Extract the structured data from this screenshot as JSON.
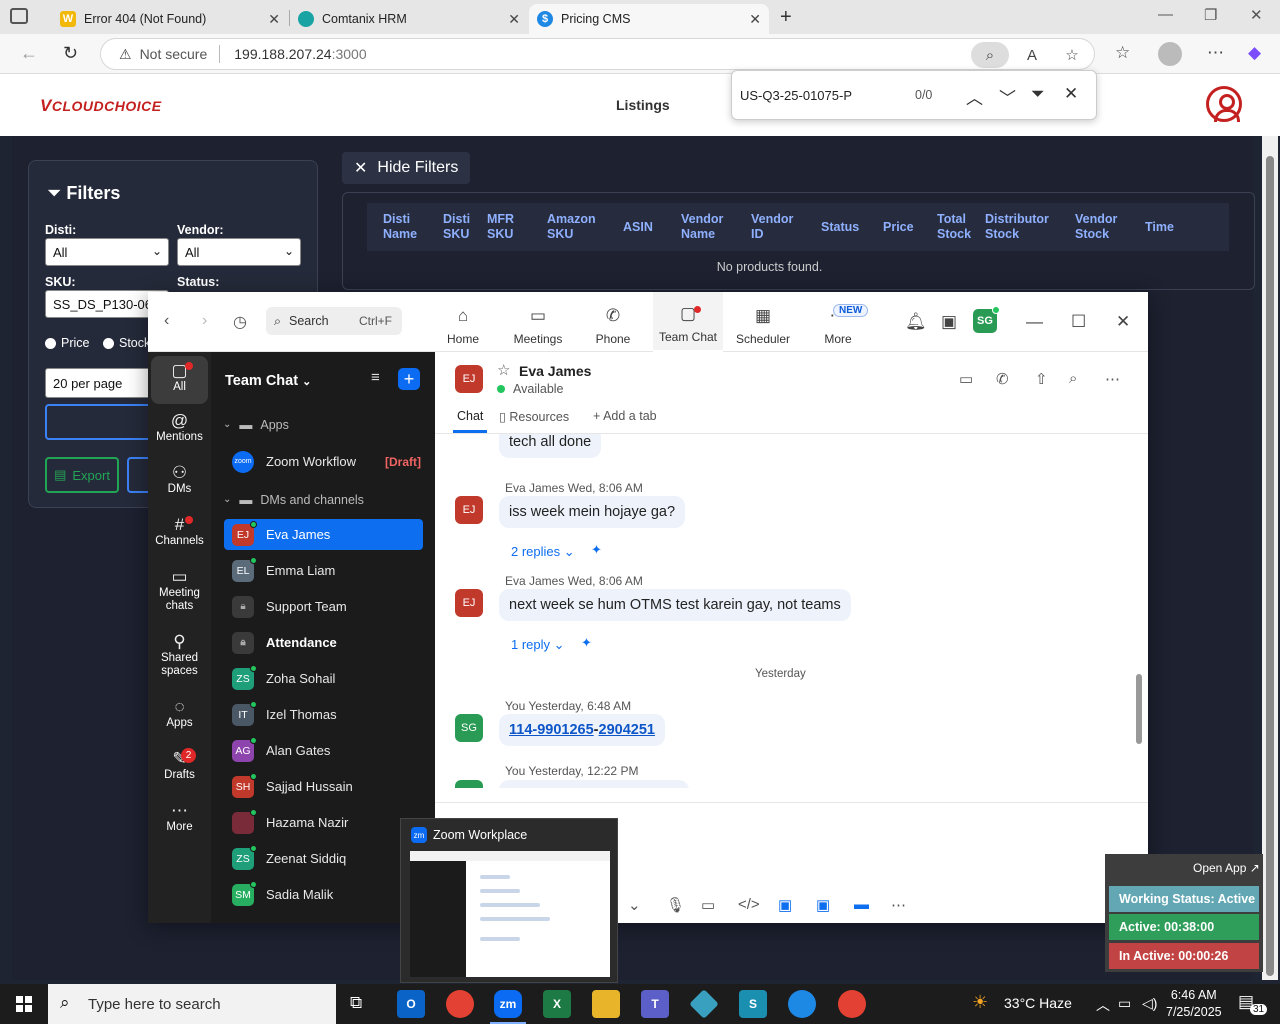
{
  "browser": {
    "tabs": [
      {
        "title": "Error 404 (Not Found)",
        "favicon": "W"
      },
      {
        "title": "Comtanix HRM"
      },
      {
        "title": "Pricing CMS",
        "active": true
      }
    ],
    "url_security": "Not secure",
    "url_host": "199.188.207.24",
    "url_port": ":3000"
  },
  "find": {
    "query": "US-Q3-25-01075-P",
    "count": "0/0"
  },
  "site": {
    "logo_v": "V",
    "logo_rest": "CLOUDCHOICE",
    "nav_listings": "Listings"
  },
  "filters": {
    "title": "Filters",
    "disti_label": "Disti:",
    "disti_value": "All",
    "vendor_label": "Vendor:",
    "vendor_value": "All",
    "sku_label": "SKU:",
    "sku_value": "SS_DS_P130-06N-",
    "status_label": "Status:",
    "radio_price": "Price",
    "radio_stock": "Stock",
    "per_page": "20 per page",
    "export": "Export",
    "hide": "Hide Filters"
  },
  "table": {
    "headers": [
      "Disti Name",
      "Disti SKU",
      "MFR SKU",
      "Amazon SKU",
      "ASIN",
      "Vendor Name",
      "Vendor ID",
      "Status",
      "Price",
      "Total Stock",
      "Distributor Stock",
      "Vendor Stock",
      "Time"
    ],
    "empty": "No products found."
  },
  "zoom": {
    "search_placeholder": "Search",
    "search_shortcut": "Ctrl+F",
    "tabs": [
      "Home",
      "Meetings",
      "Phone",
      "Team Chat",
      "Scheduler",
      "More"
    ],
    "new_badge": "NEW",
    "user_initials": "SG",
    "rail": [
      "All",
      "Mentions",
      "DMs",
      "Channels",
      "Meeting chats",
      "Shared spaces",
      "Apps",
      "Drafts",
      "More"
    ],
    "drafts_count": "2",
    "list_title": "Team Chat",
    "group_apps": "Apps",
    "zoom_workflow": "Zoom Workflow",
    "draft_tag": "[Draft]",
    "group_dms": "DMs and channels",
    "contacts": [
      {
        "initials": "EJ",
        "name": "Eva James",
        "color": "#c0392b"
      },
      {
        "initials": "EL",
        "name": "Emma Liam",
        "color": "#5b6b7a"
      },
      {
        "initials": "",
        "name": "Support Team",
        "color": "#3a3a3a"
      },
      {
        "initials": "",
        "name": "Attendance",
        "color": "#3a3a3a"
      },
      {
        "initials": "ZS",
        "name": "Zoha Sohail",
        "color": "#1f9e7a"
      },
      {
        "initials": "IT",
        "name": "Izel Thomas",
        "color": "#4a5866"
      },
      {
        "initials": "AG",
        "name": "Alan Gates",
        "color": "#8e44ad"
      },
      {
        "initials": "SH",
        "name": "Sajjad Hussain",
        "color": "#c0392b"
      },
      {
        "initials": "",
        "name": "Hazama Nazir",
        "color": "#7a2b3a"
      },
      {
        "initials": "ZS",
        "name": "Zeenat Siddiq",
        "color": "#1f9e7a"
      },
      {
        "initials": "SM",
        "name": "Sadia Malik",
        "color": "#27ae60"
      }
    ],
    "chat": {
      "name": "Eva James",
      "initials": "EJ",
      "status": "Available",
      "tab_chat": "Chat",
      "tab_resources": "Resources",
      "tab_add": "Add a tab",
      "messages": [
        {
          "text": "tech all done"
        },
        {
          "sender": "Eva James",
          "time": "Wed, 8:06 AM",
          "text": "iss week mein hojaye ga?",
          "replies": "2 replies"
        },
        {
          "sender": "Eva James",
          "time": "Wed, 8:06 AM",
          "text": "next week se hum OTMS test karein gay, not teams",
          "replies": "1 reply"
        },
        {
          "day": "Yesterday"
        },
        {
          "sender": "You",
          "time": "Yesterday, 6:48 AM",
          "link_a": "114-9901265",
          "link_dash": "-",
          "link_b": "2904251"
        },
        {
          "sender": "You",
          "time": "Yesterday, 12:22 PM"
        }
      ]
    }
  },
  "preview": {
    "title": "Zoom Workplace"
  },
  "working": {
    "open_app": "Open App ↗",
    "status": "Working Status: Active",
    "active": "Active: 00:38:00",
    "inactive": "In Active: 00:00:26"
  },
  "taskbar": {
    "search": "Type here to search",
    "weather": "33°C  Haze",
    "time": "6:46 AM",
    "date": "7/25/2025",
    "notif": "31"
  }
}
